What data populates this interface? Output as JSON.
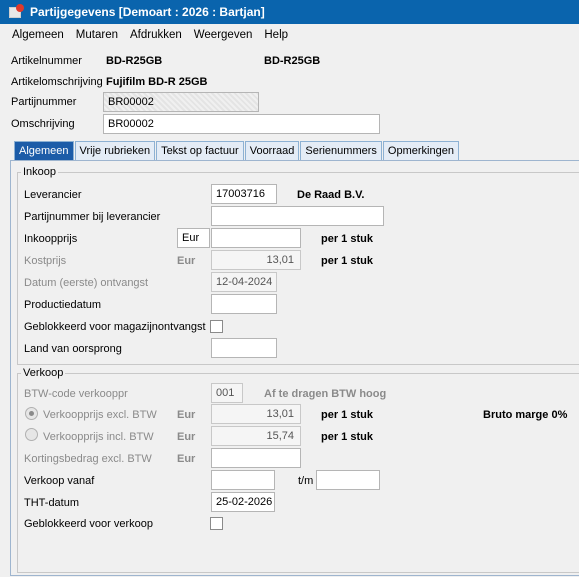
{
  "window": {
    "title": "Partijgegevens  [Demoart : 2026 : Bartjan]"
  },
  "menu": [
    "Algemeen",
    "Mutaren",
    "Afdrukken",
    "Weergeven",
    "Help"
  ],
  "header": {
    "artikelnummer_label": "Artikelnummer",
    "artikelnummer_value": "BD-R25GB",
    "artikelnummer_value2": "BD-R25GB",
    "artikelomschrijving_label": "Artikelomschrijving",
    "artikelomschrijving_value": "Fujifilm BD-R 25GB",
    "partijnummer_label": "Partijnummer",
    "partijnummer_value": "BR00002",
    "omschrijving_label": "Omschrijving",
    "omschrijving_value": "BR00002"
  },
  "tabs": [
    "Algemeen",
    "Vrije rubrieken",
    "Tekst op factuur",
    "Voorraad",
    "Serienummers",
    "Opmerkingen"
  ],
  "inkoop": {
    "title": "Inkoop",
    "leverancier_label": "Leverancier",
    "leverancier_code": "17003716",
    "leverancier_name": "De Raad B.V.",
    "partijnummer_lev_label": "Partijnummer bij leverancier",
    "partijnummer_lev_value": "",
    "inkoopprijs_label": "Inkoopprijs",
    "inkoopprijs_currency": "Eur",
    "inkoopprijs_value": "",
    "inkoopprijs_unit": "per 1 stuk",
    "kostprijs_label": "Kostprijs",
    "kostprijs_currency": "Eur",
    "kostprijs_value": "13,01",
    "kostprijs_unit": "per 1 stuk",
    "datum_label": "Datum (eerste) ontvangst",
    "datum_value": "12-04-2024",
    "productiedatum_label": "Productiedatum",
    "productiedatum_value": "",
    "geblokkeerd_label": "Geblokkeerd voor magazijnontvangst",
    "geblokkeerd_checked": false,
    "land_label": "Land van oorsprong",
    "land_value": ""
  },
  "verkoop": {
    "title": "Verkoop",
    "btw_label": "BTW-code verkooppr",
    "btw_code": "001",
    "btw_desc": "Af te dragen BTW hoog",
    "excl_label": "Verkoopprijs excl. BTW",
    "excl_currency": "Eur",
    "excl_value": "13,01",
    "excl_unit": "per 1 stuk",
    "excl_selected": true,
    "bruto_marge": "Bruto marge 0%",
    "incl_label": "Verkoopprijs incl. BTW",
    "incl_currency": "Eur",
    "incl_value": "15,74",
    "incl_unit": "per 1 stuk",
    "korting_label": "Kortingsbedrag excl. BTW",
    "korting_currency": "Eur",
    "korting_value": "",
    "vanaf_label": "Verkoop vanaf",
    "vanaf_value": "",
    "tm_label": "t/m",
    "tm_value": "",
    "tht_label": "THT-datum",
    "tht_value": "25-02-2026",
    "geblokkeerd_label": "Geblokkeerd voor verkoop",
    "geblokkeerd_checked": false
  }
}
